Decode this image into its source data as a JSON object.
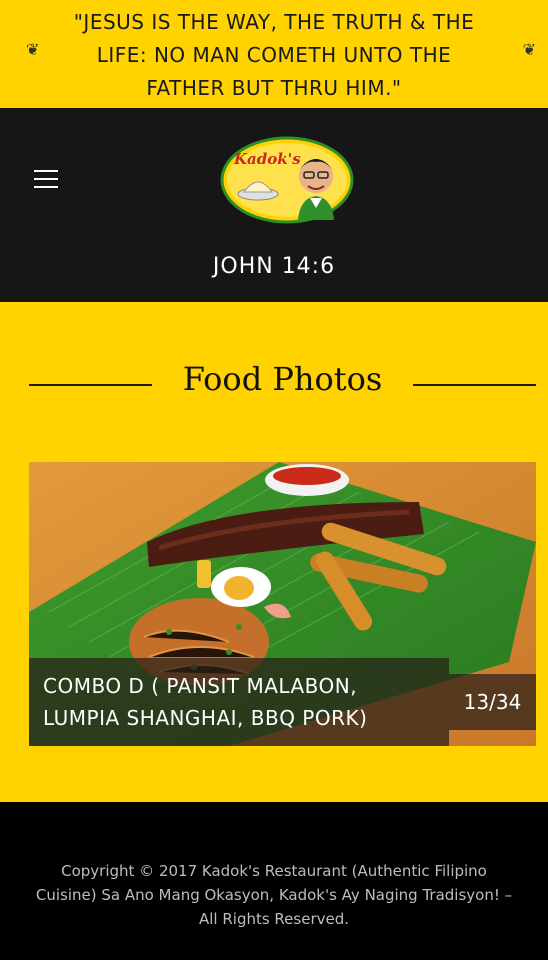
{
  "banner": {
    "quote": "\"JESUS IS THE WAY, THE TRUTH & THE LIFE: NO MAN COMETH UNTO THE FATHER BUT THRU HIM.\""
  },
  "header": {
    "logo_text": "Kadok's",
    "verse": "JOHN 14:6"
  },
  "section": {
    "title": "Food Photos"
  },
  "gallery": {
    "caption": "COMBO D ( PANSIT MALABON, LUMPIA SHANGHAI, BBQ PORK)",
    "counter": "13/34"
  },
  "footer": {
    "copyright": "Copyright © 2017 Kadok's Restaurant (Authentic Filipino Cuisine) Sa Ano Mang Okasyon, Kadok's Ay Naging Tradisyon! – All Rights Reserved."
  },
  "colors": {
    "brand_yellow": "#ffd200",
    "header_dark": "#161616",
    "footer_black": "#000000"
  }
}
